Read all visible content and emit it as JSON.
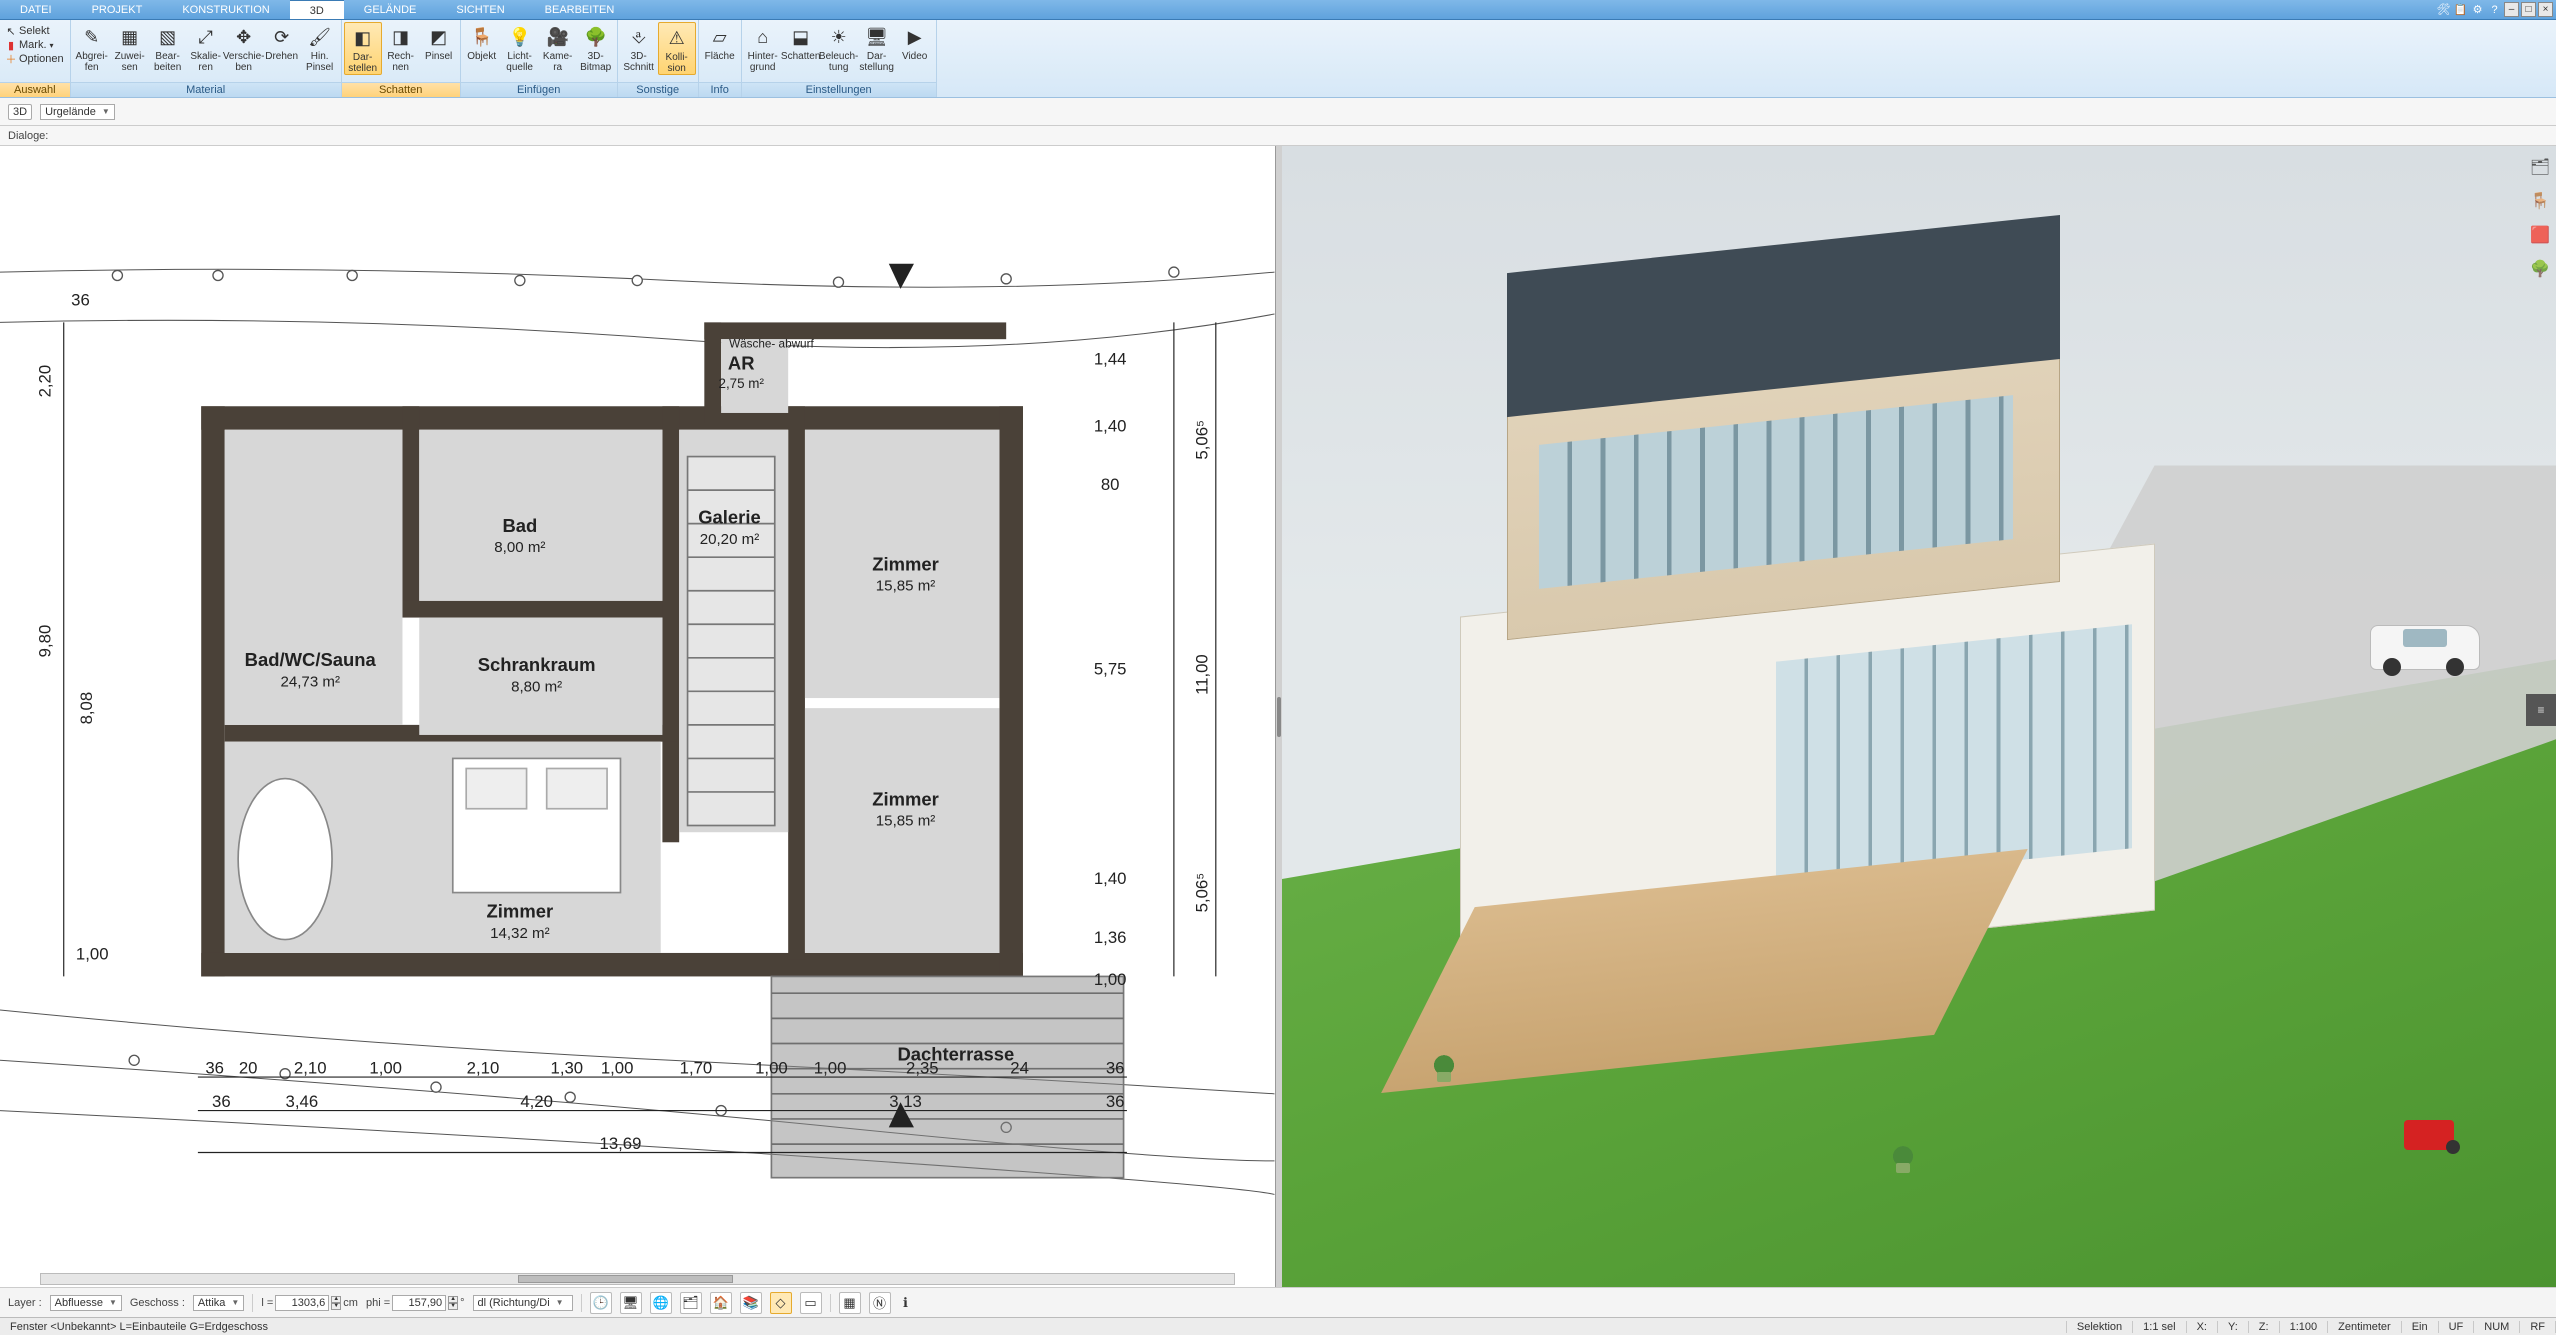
{
  "menu": {
    "tabs": [
      "DATEI",
      "PROJEKT",
      "KONSTRUKTION",
      "3D",
      "GELÄNDE",
      "SICHTEN",
      "BEARBEITEN"
    ],
    "active_index": 3
  },
  "window_buttons": {
    "min": "–",
    "max": "□",
    "close": "×"
  },
  "ribbon": {
    "selection": {
      "select": "Selekt",
      "mark": "Mark.",
      "options": "Optionen",
      "group_label": "Auswahl"
    },
    "material": {
      "items": [
        {
          "label": "Abgrei-\nfen"
        },
        {
          "label": "Zuwei-\nsen"
        },
        {
          "label": "Bear-\nbeiten"
        },
        {
          "label": "Skalie-\nren"
        },
        {
          "label": "Verschie-\nben"
        },
        {
          "label": "Drehen"
        },
        {
          "label": "Hin.\nPinsel"
        }
      ],
      "group_label": "Material"
    },
    "schatten": {
      "items": [
        {
          "label": "Dar-\nstellen"
        },
        {
          "label": "Rech-\nnen"
        },
        {
          "label": "Pinsel"
        }
      ],
      "group_label": "Schatten",
      "highlighted_index": 0
    },
    "einfuegen": {
      "items": [
        {
          "label": "Objekt"
        },
        {
          "label": "Licht-\nquelle"
        },
        {
          "label": "Kame-\nra"
        },
        {
          "label": "3D-\nBitmap"
        }
      ],
      "group_label": "Einfügen"
    },
    "sonstige": {
      "items": [
        {
          "label": "3D-\nSchnitt"
        },
        {
          "label": "Kolli-\nsion"
        }
      ],
      "group_label": "Sonstige",
      "highlighted_index": 1
    },
    "info": {
      "items": [
        {
          "label": "Fläche"
        }
      ],
      "group_label": "Info"
    },
    "einstellungen": {
      "items": [
        {
          "label": "Hinter-\ngrund"
        },
        {
          "label": "Schatten"
        },
        {
          "label": "Beleuch-\ntung"
        },
        {
          "label": "Dar-\nstellung"
        },
        {
          "label": "Video"
        }
      ],
      "group_label": "Einstellungen"
    }
  },
  "context_bar": {
    "mode": "3D",
    "terrain": "Urgelände"
  },
  "dialog_bar": {
    "label": "Dialoge:"
  },
  "floorplan": {
    "rooms": [
      {
        "name": "Bad/WC/Sauna",
        "area": "24,73 m²"
      },
      {
        "name": "Bad",
        "area": "8,00 m²"
      },
      {
        "name": "AR",
        "area": "2,75 m²"
      },
      {
        "name": "Wäsche-\nabwurf",
        "area": ""
      },
      {
        "name": "Galerie",
        "area": "20,20 m²"
      },
      {
        "name": "Schrankraum",
        "area": "8,80 m²"
      },
      {
        "name": "Zimmer",
        "area": "15,85 m²"
      },
      {
        "name": "Zimmer",
        "area": "15,85 m²"
      },
      {
        "name": "Zimmer",
        "area": "14,32 m²"
      },
      {
        "name": "Dachterrasse",
        "area": ""
      }
    ],
    "dims_bottom": [
      "36",
      "20",
      "2,10",
      "1,00",
      "2,10",
      "1,30",
      "1,00",
      "1,70",
      "1,00",
      "1,00",
      "2,35",
      "24",
      "36"
    ],
    "dims_bottom2": [
      "36",
      "3,46",
      "4,20",
      "3,13",
      "36"
    ],
    "dims_bottom_total": "13,69",
    "dims_right": [
      "1,44",
      "1,40",
      "80",
      "5,75",
      "1,40",
      "1,36",
      "1,00"
    ],
    "dims_right_outer": [
      "5,06⁵",
      "11,00",
      "5,06⁵"
    ],
    "dims_left": [
      "2,20",
      "9,80",
      "8,08"
    ],
    "dims_left_inner": [
      "36",
      "1,00"
    ]
  },
  "right_tools": [
    "layers-icon",
    "furniture-icon",
    "palette-icon",
    "tree-icon"
  ],
  "bottom": {
    "layer_label": "Layer :",
    "layer_value": "Abfluesse",
    "storey_label": "Geschoss :",
    "storey_value": "Attika",
    "l_label": "l =",
    "l_value": "1303,6",
    "l_unit": "cm",
    "phi_label": "phi =",
    "phi_value": "157,90",
    "dl_placeholder": "dl (Richtung/Di"
  },
  "status": {
    "left": "Fenster <Unbekannt> L=Einbauteile G=Erdgeschoss",
    "selection": "Selektion",
    "ratio": "1:1 sel",
    "x": "X:",
    "y": "Y:",
    "z": "Z:",
    "scale": "1:100",
    "unit": "Zentimeter",
    "ein": "Ein",
    "uf": "UF",
    "num": "NUM",
    "rf": "RF"
  }
}
